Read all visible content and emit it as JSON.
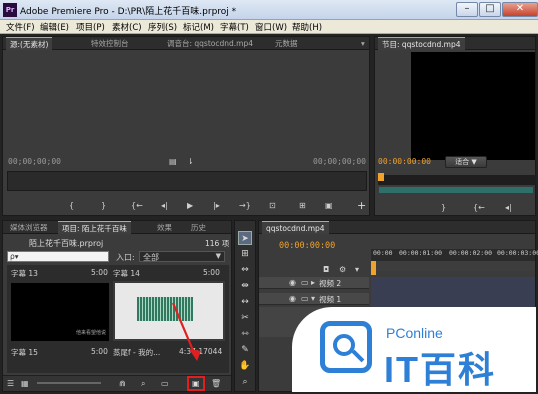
{
  "window": {
    "app_icon": "Pr",
    "title": "Adobe Premiere Pro - D:\\PR\\陌上花千百味.prproj *",
    "btn_minimize": "–",
    "btn_maximize": "□",
    "btn_close": "✕"
  },
  "menu": [
    "文件(F)",
    "编辑(E)",
    "项目(P)",
    "素材(C)",
    "序列(S)",
    "标记(M)",
    "字幕(T)",
    "窗口(W)",
    "帮助(H)"
  ],
  "source_panel": {
    "tabs": [
      "源:(无素材)",
      "特效控制台",
      "调音台: qqstocdnd.mp4",
      "元数据"
    ],
    "tab_menu": "▾",
    "timecode_left": "00;00;00;00",
    "timecode_right": "00;00;00;00",
    "add_button": "+"
  },
  "program_panel": {
    "tab": "节目: qqstocdnd.mp4",
    "timecode": "00:00:00:00",
    "fit_label": "适合",
    "fit_arrow": "▼"
  },
  "project_panel": {
    "tabs": [
      "媒体浏览器",
      "项目: 陌上花千百味",
      "效果",
      "历史"
    ],
    "filename": "陌上花千百味.prproj",
    "item_count": "116 项",
    "search_placeholder": "ρ▾",
    "in_label": "入口:",
    "in_value": "全部",
    "items": [
      {
        "name": "字幕 13",
        "duration": "5:00"
      },
      {
        "name": "字幕 14",
        "duration": "5:00"
      },
      {
        "name": "字幕 15",
        "duration": "5:00"
      },
      {
        "name": "蒸尾f - 我的...",
        "duration": "4:37;17044"
      }
    ],
    "thumb_caption": "他来看望他说"
  },
  "sequence_panel": {
    "tab": "qqstocdnd.mp4",
    "timecode": "00:00:00:00",
    "ruler": [
      "00:00",
      "00:00:01:00",
      "00:00:02:00",
      "00:00:03:00"
    ],
    "tracks": [
      "视频 2",
      "视频 1"
    ]
  },
  "watermark": {
    "brand": "PConline",
    "logo_text": "IT百科",
    "glyph": "I"
  },
  "colors": {
    "accent_orange": "#f0a22a",
    "highlight_red": "#e02020",
    "watermark_blue": "#2e7fd6"
  },
  "icons": [
    "selection-tool-icon",
    "track-select-icon",
    "ripple-edit-icon",
    "razor-icon",
    "hand-icon",
    "zoom-icon",
    "new-item-icon",
    "delete-icon"
  ]
}
